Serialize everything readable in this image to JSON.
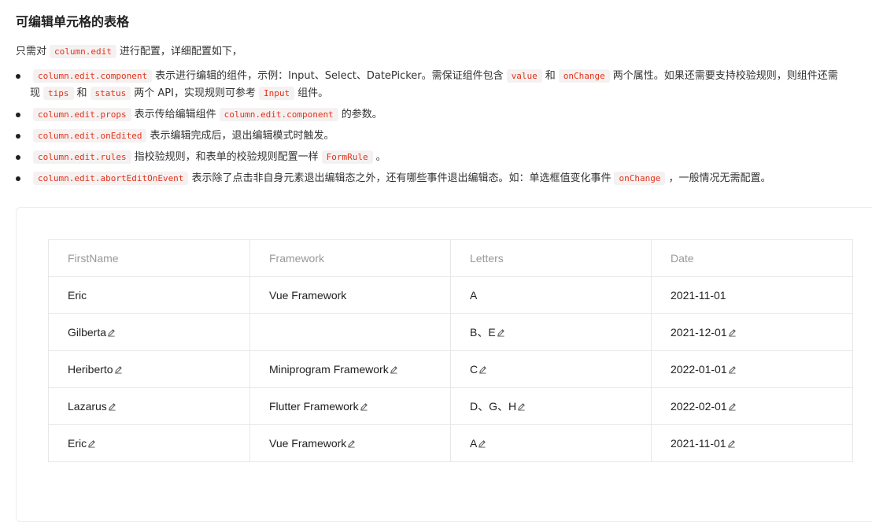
{
  "page": {
    "title": "可编辑单元格的表格",
    "intro_before": "只需对",
    "intro_code": "column.edit",
    "intro_after": "进行配置，详细配置如下，"
  },
  "bullets": [
    {
      "code1": "column.edit.component",
      "text1": "表示进行编辑的组件，示例：Input、Select、DatePicker。需保证组件包含",
      "code2": "value",
      "text2": "和",
      "code3": "onChange",
      "text3": "两个属性。如果还需要支持校验规则，则组件还需",
      "line2_text1": "现",
      "line2_code1": "tips",
      "line2_text2": "和",
      "line2_code2": "status",
      "line2_text3": "两个 API，实现规则可参考",
      "line2_code3": "Input",
      "line2_text4": "组件。"
    },
    {
      "code1": "column.edit.props",
      "text1": "表示传给编辑组件",
      "code2": "column.edit.component",
      "text2": "的参数。"
    },
    {
      "code1": "column.edit.onEdited",
      "text1": "表示编辑完成后，退出编辑模式时触发。"
    },
    {
      "code1": "column.edit.rules",
      "text1": "指校验规则，和表单的校验规则配置一样",
      "code2": "FormRule",
      "text2": "。"
    },
    {
      "code1": "column.edit.abortEditOnEvent",
      "text1": "表示除了点击非自身元素退出编辑态之外，还有哪些事件退出编辑态。如：单选框值变化事件",
      "code2": "onChange",
      "text2": "，一般情况无需配置。"
    }
  ],
  "table": {
    "columns": [
      "FirstName",
      "Framework",
      "Letters",
      "Date"
    ],
    "rows": [
      [
        "Eric",
        "Vue Framework",
        "A",
        "2021-11-01"
      ],
      [
        "Gilberta",
        "",
        "B、E",
        "2021-12-01"
      ],
      [
        "Heriberto",
        "Miniprogram Framework",
        "C",
        "2022-01-01"
      ],
      [
        "Lazarus",
        "Flutter Framework",
        "D、G、H",
        "2022-02-01"
      ],
      [
        "Eric",
        "Vue Framework",
        "A",
        "2021-11-01"
      ]
    ],
    "editable_icon": "edit-pencil-icon"
  },
  "colors": {
    "code_text": "#e0331b",
    "code_bg": "#f6f1f1",
    "border": "#e7e7e7",
    "header_text": "#999999"
  }
}
